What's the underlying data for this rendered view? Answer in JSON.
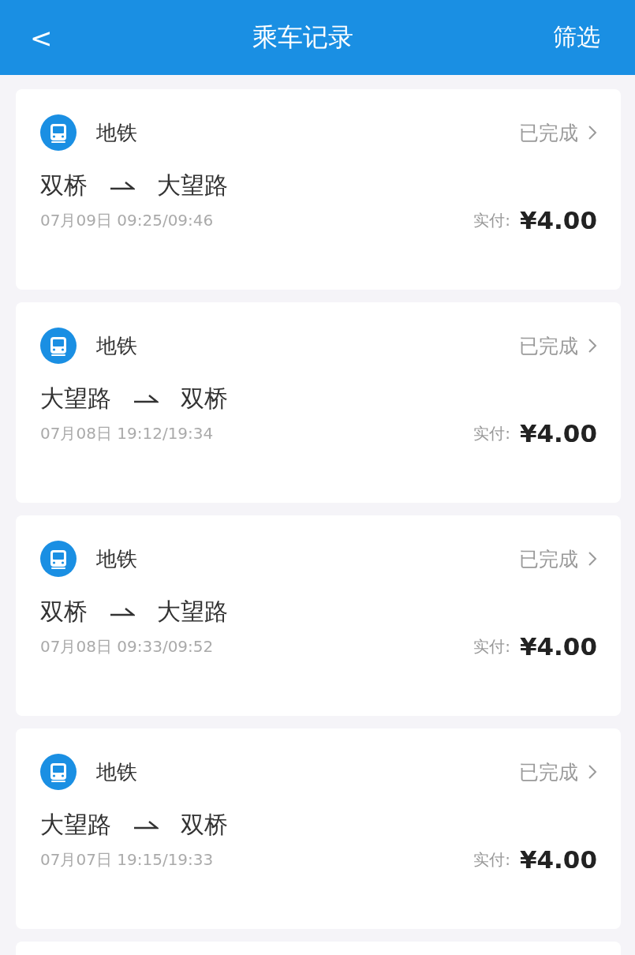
{
  "header": {
    "back": "<",
    "title": "乘车记录",
    "filter": "筛选"
  },
  "records": [
    {
      "type": "地铁",
      "status": "已完成",
      "from": "双桥",
      "to": "大望路",
      "time": "07月09日 09:25/09:46",
      "paid_label": "实付:",
      "amount": "¥4.00"
    },
    {
      "type": "地铁",
      "status": "已完成",
      "from": "大望路",
      "to": "双桥",
      "time": "07月08日 19:12/19:34",
      "paid_label": "实付:",
      "amount": "¥4.00"
    },
    {
      "type": "地铁",
      "status": "已完成",
      "from": "双桥",
      "to": "大望路",
      "time": "07月08日 09:33/09:52",
      "paid_label": "实付:",
      "amount": "¥4.00"
    },
    {
      "type": "地铁",
      "status": "已完成",
      "from": "大望路",
      "to": "双桥",
      "time": "07月07日 19:15/19:33",
      "paid_label": "实付:",
      "amount": "¥4.00"
    }
  ]
}
